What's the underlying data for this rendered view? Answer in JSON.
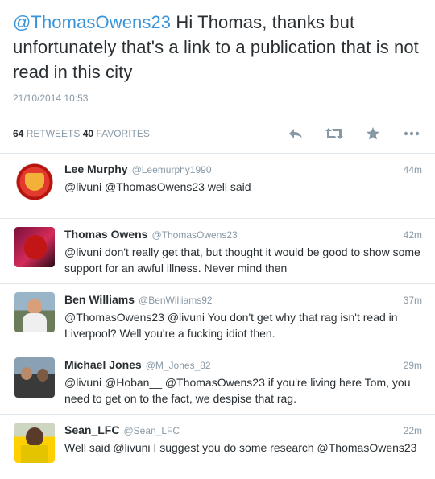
{
  "main_tweet": {
    "mention": "@ThomasOwens23",
    "text": " Hi Thomas, thanks but unfortunately that's a link to a publication that is not read in this city",
    "timestamp": "21/10/2014 10:53"
  },
  "stats": {
    "retweets_count": "64",
    "retweets_label": "RETWEETS",
    "favorites_count": "40",
    "favorites_label": "FAVORITES"
  },
  "actions": [
    "reply-icon",
    "retweet-icon",
    "favorite-icon",
    "more-icon"
  ],
  "colors": {
    "link": "#3b94d9",
    "muted": "#8899a6",
    "text": "#292f33",
    "divider": "#e1e8ed"
  },
  "replies": [
    {
      "name": "Lee Murphy",
      "handle": "@Leemurphy1990",
      "time": "44m",
      "text": "@livuni @ThomasOwens23 well said"
    },
    {
      "name": "Thomas Owens",
      "handle": "@ThomasOwens23",
      "time": "42m",
      "text": "@livuni don't really get that, but thought it would be good to show some support for an awful illness. Never mind then"
    },
    {
      "name": "Ben Williams",
      "handle": "@BenWilliams92",
      "time": "37m",
      "text": "@ThomasOwens23 @livuni You don't get why that rag isn't read in Liverpool? Well you're a fucking idiot then."
    },
    {
      "name": "Michael Jones",
      "handle": "@M_Jones_82",
      "time": "29m",
      "text": "@livuni @Hoban__ @ThomasOwens23 if you're living here Tom, you need to get on to the fact, we despise that rag."
    },
    {
      "name": "Sean_LFC",
      "handle": "@Sean_LFC",
      "time": "22m",
      "text": "Well said @livuni  I suggest you do some research @ThomasOwens23"
    }
  ]
}
